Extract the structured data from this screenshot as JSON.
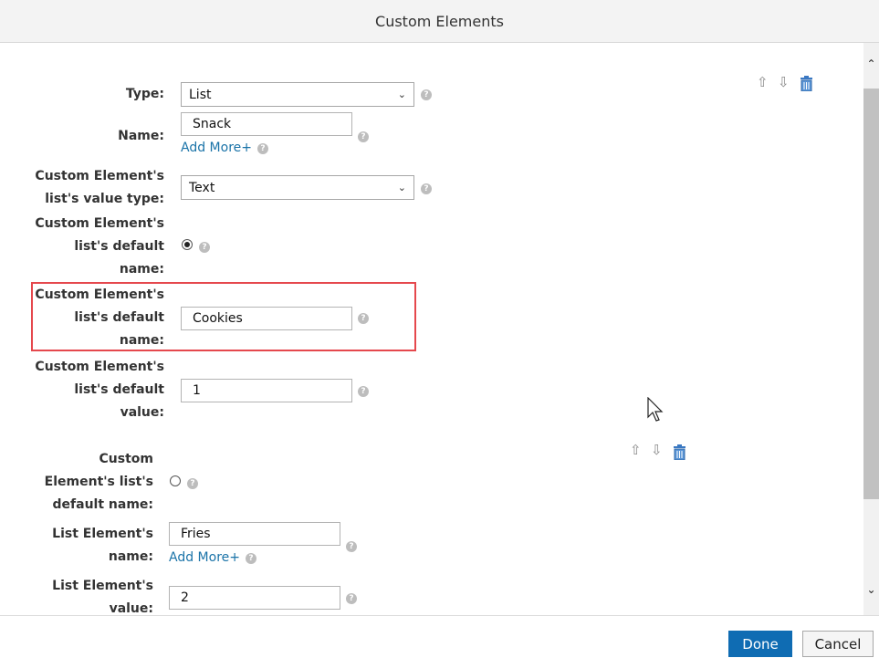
{
  "dialog": {
    "title": "Custom Elements"
  },
  "form": {
    "type": {
      "label": "Type:",
      "value": "List"
    },
    "name": {
      "label": "Name:",
      "value": "Snack",
      "add_more": "Add More+"
    },
    "value_type": {
      "label": "Custom Element's\nlist's value type:",
      "value": "Text"
    },
    "default_name_radio": {
      "label": "Custom Element's\nlist's default\nname:",
      "checked": true
    },
    "default_name_input": {
      "label": "Custom Element's\nlist's default\nname:",
      "value": "Cookies"
    },
    "default_value": {
      "label": "Custom Element's\nlist's default\nvalue:",
      "value": "1"
    },
    "list_element_radio": {
      "label": "Custom\nElement's list's\ndefault name:",
      "checked": false
    },
    "list_element_name": {
      "label": "List Element's\nname:",
      "value": "Fries",
      "add_more": "Add More+"
    },
    "list_element_value": {
      "label": "List Element's\nvalue:",
      "value": "2"
    }
  },
  "icons": {
    "help": "?",
    "move_up": "⇧",
    "move_down": "⇩",
    "scroll_up": "⌃",
    "scroll_down": "⌄"
  },
  "footer": {
    "done_label": "Done",
    "cancel_label": "Cancel"
  },
  "colors": {
    "accent": "#0f6cb3",
    "highlight": "#e5484d",
    "link": "#1a73a8"
  }
}
